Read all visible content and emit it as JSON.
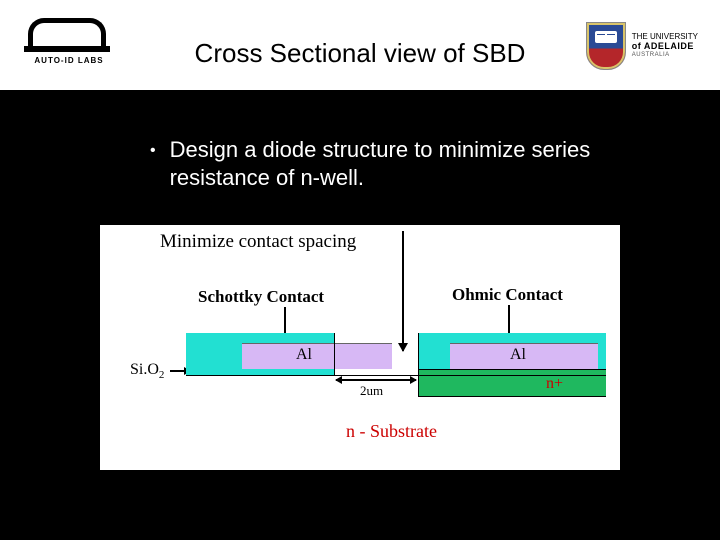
{
  "header": {
    "logo_left_label": "AUTO-ID LABS",
    "title": "Cross Sectional view of SBD",
    "uni": {
      "line1": "THE UNIVERSITY",
      "line2": "of ADELAIDE",
      "line3": "AUSTRALIA"
    }
  },
  "bullets": [
    "Design a diode structure to minimize series resistance of n-well."
  ],
  "diagram": {
    "title": "Minimize contact spacing",
    "schottky": "Schottky Contact",
    "ohmic": "Ohmic Contact",
    "sio2": "Si.O",
    "sio2_sub": "2",
    "al": "Al",
    "nplus": "n+",
    "substrate": "n - Substrate",
    "gap": "2um"
  }
}
